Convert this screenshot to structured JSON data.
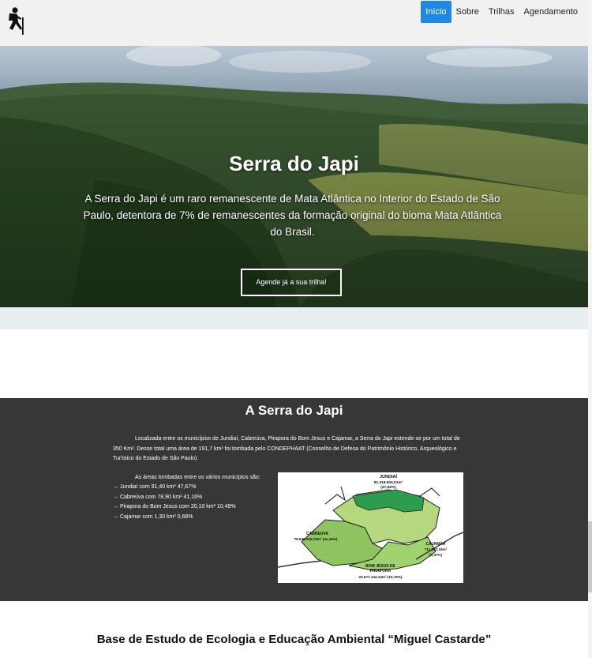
{
  "nav": {
    "items": [
      {
        "label": "Início",
        "active": true
      },
      {
        "label": "Sobre",
        "active": false
      },
      {
        "label": "Trilhas",
        "active": false
      },
      {
        "label": "Agendamento",
        "active": false
      }
    ],
    "logo_icon": "hiker-icon",
    "accent": "#1e88e5"
  },
  "hero": {
    "title": "Serra do Japi",
    "text": "A Serra do Japi é um raro remanescente de Mata Atlântica no Interior do Estado de São Paulo, detentora de 7% de remanescentes da formação original do bioma Mata Atlântica do Brasil.",
    "button_label": "Agende já a sua trilha!"
  },
  "about": {
    "title": "A Serra do Japi",
    "paragraph": "Localizada entre os municípios de Jundiaí, Cabreúva, Pirapora do Bom Jesus e Cajamar, a Serra do Japi estende-se por um total de 350 Km². Desse total uma área de 191,7 km² foi tombada pelo CONDEPHAAT (Conselho de Defesa do Patrimônio Histórico, Arqueológico e Turístico do Estado de São Paulo).",
    "areas_intro": "As áreas tombadas entre os vários municípios são:",
    "areas": [
      "→ Jundiaí com 91,40 km² 47,67%",
      "→ Cabreúva com 78,90 km² 41,16%",
      "→ Pirapora do Bom Jesus com 20,10 km² 10,49%",
      "→ Cajamar com 1,30 km² 0,68%"
    ],
    "map_labels": {
      "jundiai": "JUNDIAÍ",
      "jundiai_area": "91.318.604,01m²",
      "jundiai_pct": "(47,66%)",
      "cabreuva": "CABREUVA",
      "cabreuva_area": "78.946.245,70m² (41,19%)",
      "cajamar": "CAJAMAR",
      "cajamar_area": "711.507,15m²",
      "cajamar_pct": "(0,37%)",
      "bom_jesus": "BOM JESUS DE",
      "pirapora": "PIRAPORA",
      "pirapora_area": "20.677.142,14m² (10,79%)"
    }
  },
  "next_section": {
    "title": "Base de Estudo de Ecologia e Educação Ambiental “Miguel Castarde”"
  }
}
